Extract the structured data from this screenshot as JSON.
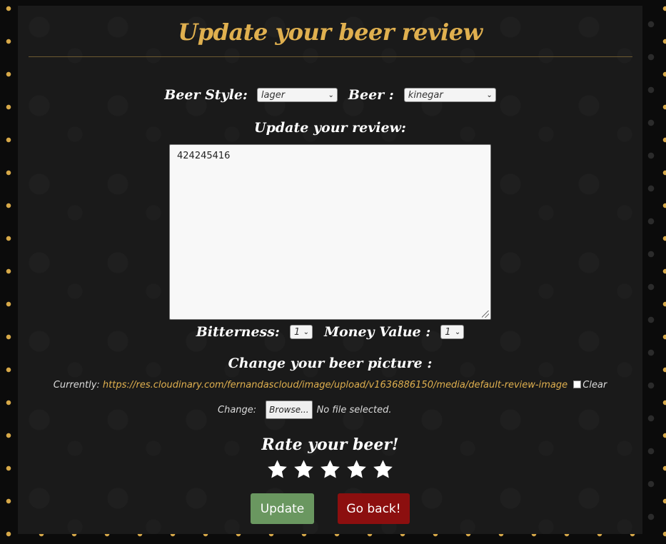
{
  "page": {
    "title": "Update your beer review"
  },
  "form": {
    "beer_style_label": "Beer Style:",
    "beer_style_value": "lager",
    "beer_label": "Beer :",
    "beer_value": "kinegar",
    "review_heading": "Update your review:",
    "review_text": "424245416",
    "bitterness_label": "Bitterness:",
    "bitterness_value": "1",
    "money_value_label": "Money Value :",
    "money_value_value": "1",
    "picture_heading": "Change your beer picture :",
    "currently_label": "Currently:",
    "current_picture_url": "https://res.cloudinary.com/fernandascloud/image/upload/v1636886150/media/default-review-image",
    "clear_label": "Clear",
    "change_label": "Change:",
    "browse_label": "Browse...",
    "no_file_text": "No file selected.",
    "rate_heading": "Rate your beer!",
    "rating": {
      "stars_total": 5
    }
  },
  "buttons": {
    "update_label": "Update",
    "back_label": "Go back!"
  },
  "colors": {
    "accent": "#e0b04f",
    "update": "#6a9760",
    "back": "#8c0f0f"
  }
}
